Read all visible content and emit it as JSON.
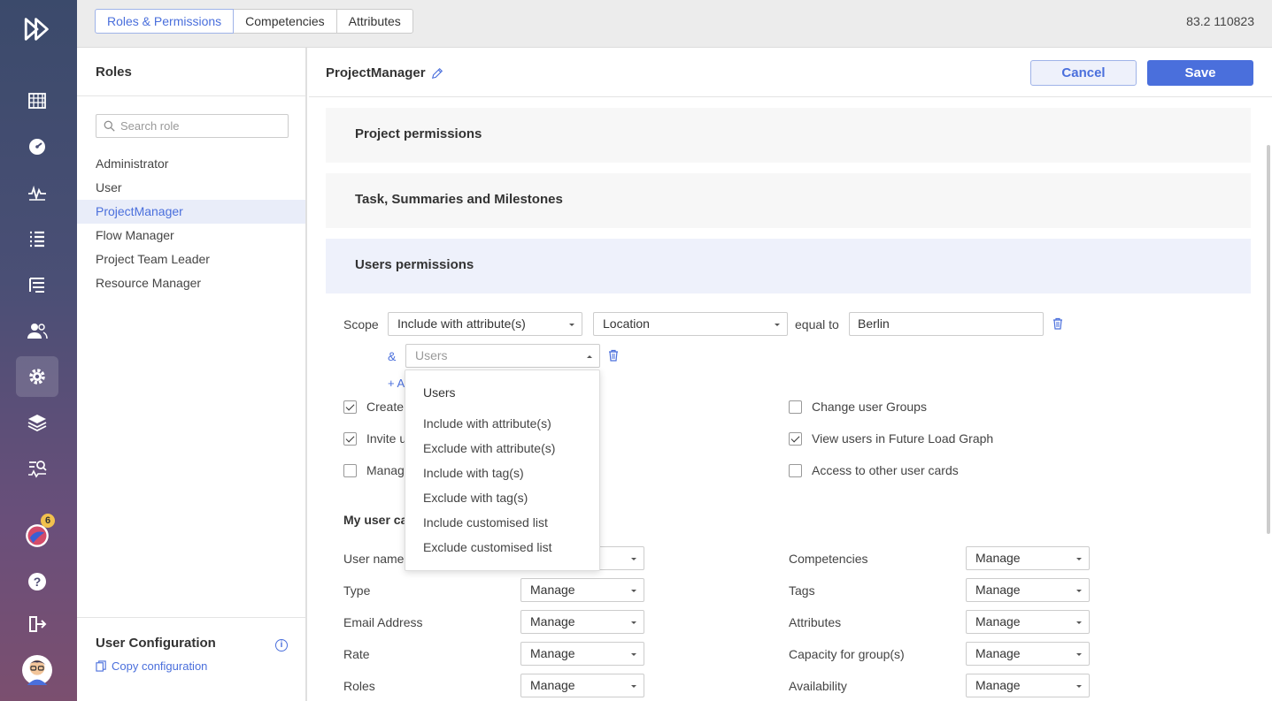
{
  "top_tabs": [
    "Roles & Permissions",
    "Competencies",
    "Attributes"
  ],
  "version": "83.2 110823",
  "roles_panel": {
    "title": "Roles",
    "search_placeholder": "Search role",
    "roles": [
      "Administrator",
      "User",
      "ProjectManager",
      "Flow Manager",
      "Project Team Leader",
      "Resource Manager"
    ],
    "active_index": 2,
    "user_config_title": "User Configuration",
    "copy_label": "Copy configuration"
  },
  "main": {
    "role_name": "ProjectManager",
    "cancel_label": "Cancel",
    "save_label": "Save",
    "sections": [
      "Project permissions",
      "Task, Summaries and Milestones",
      "Users permissions"
    ],
    "scope": {
      "label": "Scope",
      "mode": "Include with attribute(s)",
      "attribute": "Location",
      "operator_label": "equal to",
      "value": "Berlin",
      "and_label": "&",
      "second_select_placeholder": "Users",
      "add_label": "+ A"
    },
    "checkboxes_left": [
      {
        "label": "Create",
        "checked": true
      },
      {
        "label": "Invite u",
        "checked": true
      },
      {
        "label": "Manag",
        "checked": false
      }
    ],
    "checkboxes_right": [
      {
        "label": "Change user Groups",
        "checked": false
      },
      {
        "label": "View users in Future Load Graph",
        "checked": true
      },
      {
        "label": "Access to other user cards",
        "checked": false
      }
    ],
    "my_user_card_label": "My user ca",
    "fields_left": [
      {
        "label": "User name",
        "value": ""
      },
      {
        "label": "Type",
        "value": "Manage"
      },
      {
        "label": "Email Address",
        "value": "Manage"
      },
      {
        "label": "Rate",
        "value": "Manage"
      },
      {
        "label": "Roles",
        "value": "Manage"
      }
    ],
    "fields_right": [
      {
        "label": "Competencies",
        "value": "Manage"
      },
      {
        "label": "Tags",
        "value": "Manage"
      },
      {
        "label": "Attributes",
        "value": "Manage"
      },
      {
        "label": "Capacity for group(s)",
        "value": "Manage"
      },
      {
        "label": "Availability",
        "value": "Manage"
      }
    ]
  },
  "dropdown": {
    "title": "Users",
    "items": [
      "Include with attribute(s)",
      "Exclude with attribute(s)",
      "Include with tag(s)",
      "Exclude with tag(s)",
      "Include customised list",
      "Exclude customised list"
    ]
  },
  "rail": {
    "notification_count": "6",
    "icons": [
      "logo-icon",
      "grid-icon",
      "dashboard-icon",
      "activity-icon",
      "list-icon",
      "tree-list-icon",
      "users-icon",
      "gear-icon",
      "layers-icon",
      "analytics-icon",
      "notifications-icon",
      "help-icon",
      "logout-icon",
      "avatar"
    ]
  }
}
